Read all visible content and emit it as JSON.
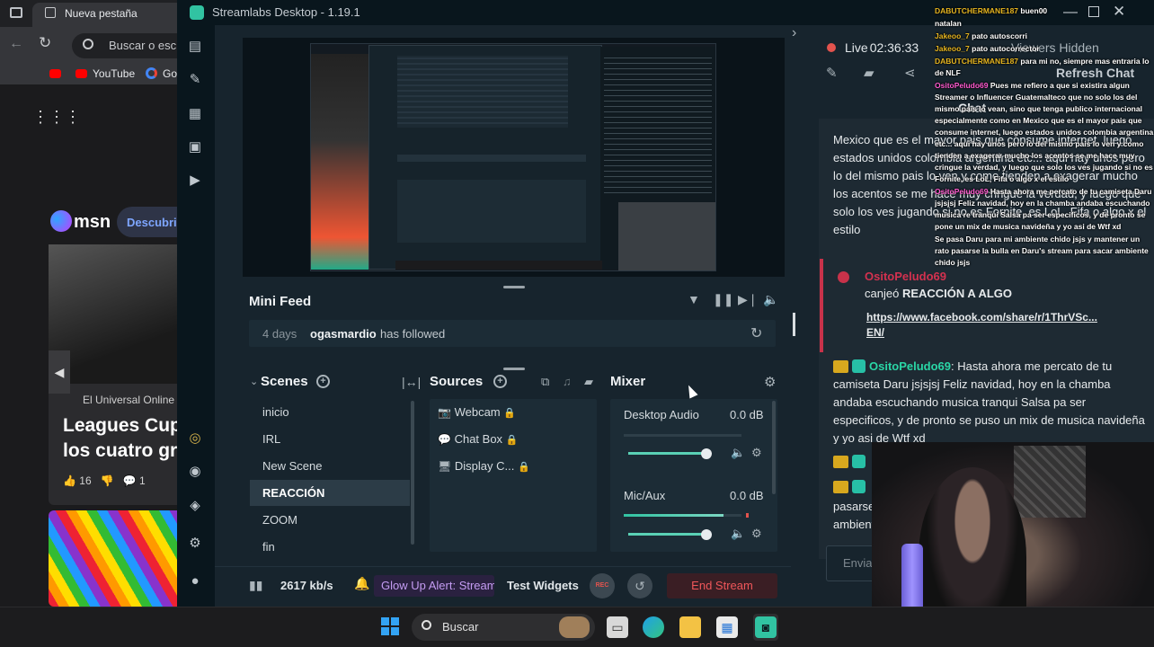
{
  "browser": {
    "tab_title": "Nueva pestaña",
    "address_placeholder": "Buscar o escr",
    "bookmarks": [
      "YouTube",
      "Go"
    ],
    "msn": {
      "logo": "msn",
      "discover_button": "Descubri",
      "card_source": "El Universal Online ·",
      "card_headline": "Leagues Cup los cuatro gr",
      "likes": "16",
      "comments": "1"
    }
  },
  "window": {
    "title": "Streamlabs Desktop - 1.19.1"
  },
  "mini_feed": {
    "title": "Mini Feed",
    "items": [
      {
        "time": "4 days",
        "user": "ogasmardio",
        "action": "has followed"
      }
    ]
  },
  "scenes": {
    "title": "Scenes",
    "items": [
      "inicio",
      "IRL",
      "New Scene",
      "REACCIÓN",
      "ZOOM",
      "fin"
    ],
    "active": "REACCIÓN"
  },
  "sources": {
    "title": "Sources",
    "items": [
      {
        "name": "Webcam",
        "icon": "camera-icon"
      },
      {
        "name": "Chat Box",
        "icon": "chat-icon"
      },
      {
        "name": "Display C...",
        "icon": "monitor-icon"
      }
    ]
  },
  "mixer": {
    "title": "Mixer",
    "channels": [
      {
        "name": "Desktop Audio",
        "db": "0.0 dB",
        "level": 0.0,
        "volume": 0.95
      },
      {
        "name": "Mic/Aux",
        "db": "0.0 dB",
        "level": 0.85,
        "volume": 0.95
      }
    ]
  },
  "footer": {
    "bitrate": "2617 kb/s",
    "glow_up": "Glow Up Alert: Stream",
    "test_widgets": "Test Widgets",
    "rec_label": "REC",
    "end_stream": "End Stream"
  },
  "live": {
    "label": "Live",
    "time": "02:36:33",
    "viewers": "Viewers Hidden",
    "refresh_chat": "Refresh Chat",
    "chat_title": "Chat"
  },
  "chat": {
    "partial_message": "Mexico que es el mayor pais que consume internet, luego estados unidos colombia argentina etc... aqui hay unos pero lo del mismo pais lo ven y como tienden a exagerar mucho los acentos se me hace muy cringue la verdad, y luego que solo los ves jugando si no es Fornite, es LoL, Fifa o algo x el estilo",
    "redemption_user": "OsitoPeludo69",
    "redemption_text": "canjeó",
    "redemption_reward": "REACCIÓN A ALGO",
    "redemption_link": "https://www.facebook.com/share/r/1ThrVSc... EN/",
    "message_user": "OsitoPeludo69",
    "message_text": "Hasta ahora me percato de tu camiseta Daru jsjsjsj Feliz navidad, hoy en la chamba andaba escuchando musica tranqui Salsa pa ser especificos, y de pronto se puso un mix de musica navideña y yo asi de Wtf xd",
    "message_cut": "pasarse ambient",
    "input_placeholder": "Envia"
  },
  "overlay_chat": [
    {
      "user": "DABUTCHERMANE187",
      "text": "buen00"
    },
    {
      "user": "",
      "text": "natalan"
    },
    {
      "user": "Jakeoo_7",
      "text": "pato autoscorri"
    },
    {
      "user": "Jakeoo_7",
      "text": "pato autocorrector"
    },
    {
      "user": "DABUTCHERMANE187",
      "text": "para mi no, siempre mas entraria lo de NLF"
    },
    {
      "user": "OsitoPeludo69",
      "text": "Pues me refiero a que si existira algun Streamer o Influencer Guatemalteco que no solo los del mismo pais lo vean, sino que tenga publico internacional especialmente como en Mexico que es el mayor pais que consume internet, luego estados unidos colombia argentina etc... aqui hay unos pero lo del mismo pais lo ven y como tienden a exagerar mucho los acentos se me hace muy cringue la verdad, y luego que solo los ves jugando si no es Fornite, es LoL, Fifa o algo x el estilo"
    },
    {
      "user": "OsitoPeludo69",
      "text": "Hasta ahora me percato de tu camiseta Daru jsjsjsj Feliz navidad, hoy en la chamba andaba escuchando musica re tranqui Salsa pa ser especificos, y de pronto se pone un mix de musica navideña y yo asi de Wtf xd"
    },
    {
      "user": "",
      "text": "Se pasa Daru para mi ambiente chido jsjs y mantener un rato pasarse la bulla en Daru's stream para sacar ambiente chido jsjs"
    }
  ],
  "taskbar": {
    "search_label": "Buscar"
  },
  "colors": {
    "accent": "#31c3a2",
    "live_red": "#e3534d",
    "end_stream_red": "#f0575a",
    "glow_purple": "#c49cf2"
  }
}
